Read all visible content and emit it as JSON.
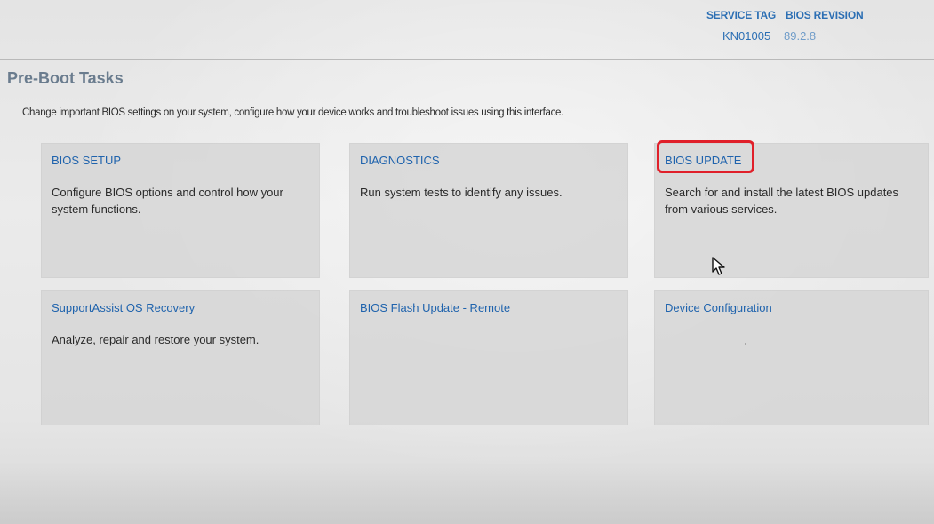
{
  "header": {
    "service_tag_label": "SERVICE TAG",
    "service_tag_value": "KN01005",
    "bios_revision_label": "BIOS REVISION",
    "bios_revision_value": "89.2.8"
  },
  "page": {
    "title": "Pre-Boot Tasks",
    "description": "Change important BIOS settings on your system, configure how your device works and troubleshoot issues using this interface."
  },
  "tiles": [
    {
      "title": "BIOS SETUP",
      "description": "Configure BIOS options and control how your system functions."
    },
    {
      "title": "DIAGNOSTICS",
      "description": "Run system tests to identify any issues."
    },
    {
      "title": "BIOS UPDATE",
      "description": "Search for and install the latest BIOS updates from various services."
    },
    {
      "title": "SupportAssist OS Recovery",
      "description": "Analyze, repair and restore your system."
    },
    {
      "title": "BIOS Flash Update - Remote",
      "description": ""
    },
    {
      "title": "Device Configuration",
      "description": ""
    }
  ],
  "colors": {
    "accent": "#1f63ad",
    "highlight": "#e0202a",
    "title_gray": "#6a7c8e"
  },
  "icons": {
    "cursor": "mouse-pointer-icon"
  }
}
